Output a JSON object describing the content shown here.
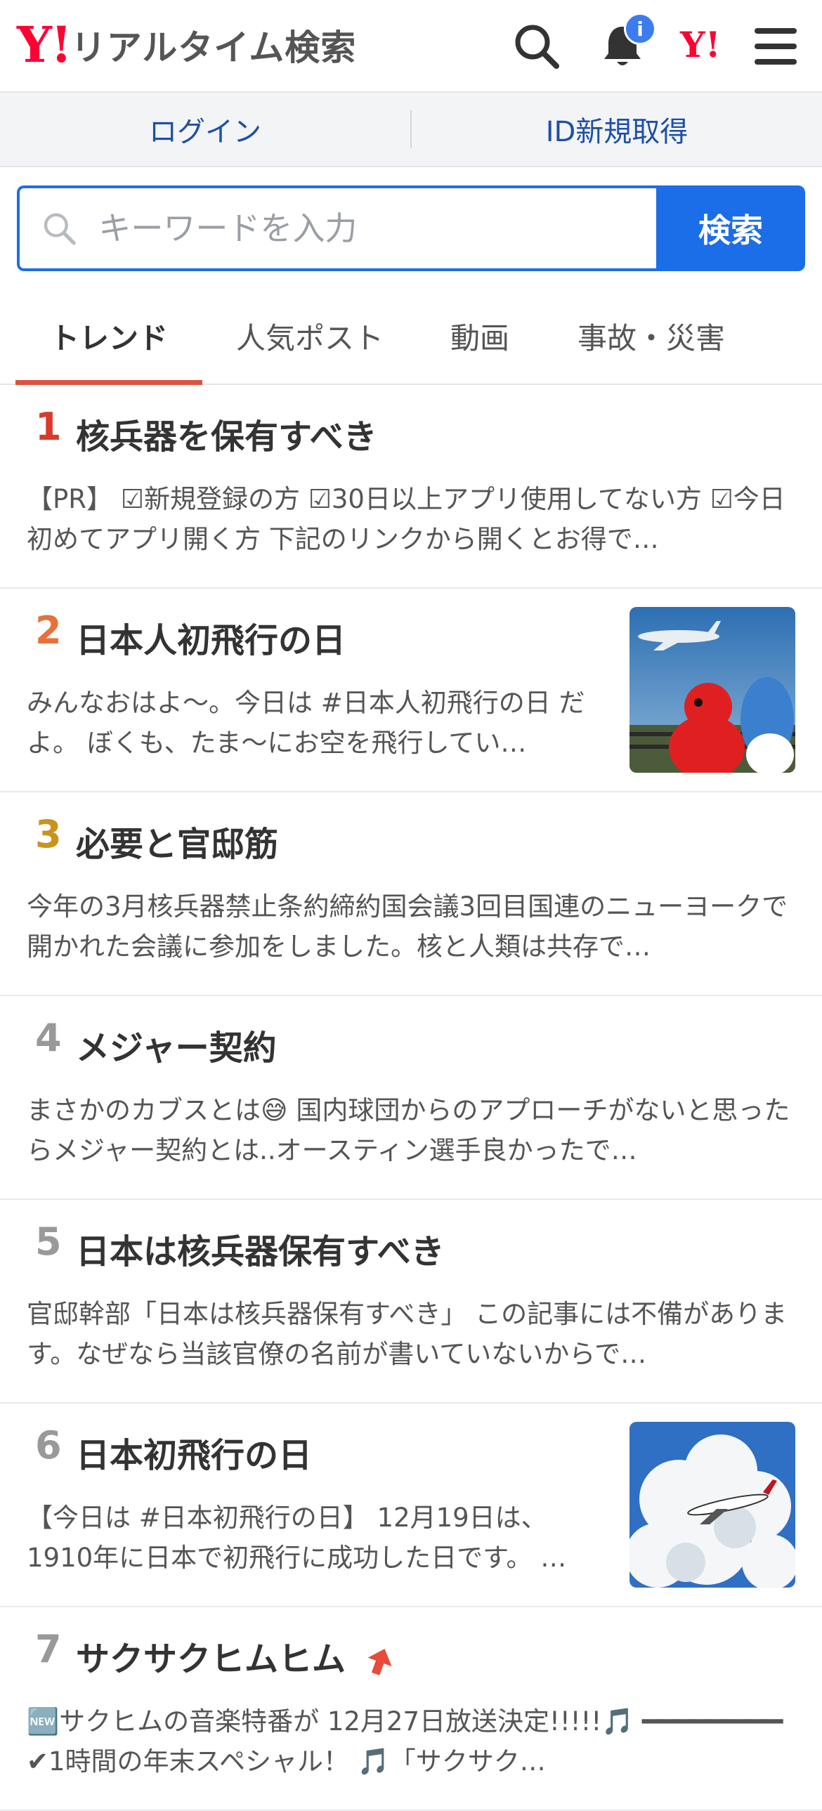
{
  "header": {
    "logo_mark": "Y!",
    "logo_text": "リアルタイム検索",
    "notification_badge": "i",
    "yahoo_mark": "Y!"
  },
  "loginbar": {
    "login": "ログイン",
    "signup": "ID新規取得"
  },
  "search": {
    "placeholder": "キーワードを入力",
    "button": "検索"
  },
  "tabs": [
    {
      "label": "トレンド",
      "active": true
    },
    {
      "label": "人気ポスト",
      "active": false
    },
    {
      "label": "動画",
      "active": false
    },
    {
      "label": "事故・災害",
      "active": false
    }
  ],
  "colors": {
    "accent_blue": "#1c6ee8",
    "tab_underline": "#e0513e",
    "rank1": "#d93a2b",
    "rank2": "#e8703a",
    "rank3": "#c9941c",
    "rank_other": "#999999"
  },
  "trends": [
    {
      "rank": "1",
      "title": "核兵器を保有すべき",
      "text": "【PR】 ☑新規登録の方 ☑30日以上アプリ使用してない方 ☑今日初めてアプリ開く方 下記のリンクから開くとお得で…",
      "image": null
    },
    {
      "rank": "2",
      "title": "日本人初飛行の日",
      "text": "みんなおはよ〜。今日は #日本人初飛行の日 だよ。 ぼくも、たま〜にお空を飛行してい…",
      "image": "airplane-with-mascot"
    },
    {
      "rank": "3",
      "title": "必要と官邸筋",
      "text": "今年の3月核兵器禁止条約締約国会議3回目国連のニューヨークで開かれた会議に参加をしました。核と人類は共存で…",
      "image": null
    },
    {
      "rank": "4",
      "title": "メジャー契約",
      "text": "まさかのカブスとは😅 国内球団からのアプローチがないと思ったらメジャー契約とは..オースティン選手良かったで…",
      "image": null
    },
    {
      "rank": "5",
      "title": "日本は核兵器保有すべき",
      "text": "官邸幹部「日本は核兵器保有すべき」 この記事には不備があります。なぜなら当該官僚の名前が書いていないからで…",
      "image": null
    },
    {
      "rank": "6",
      "title": "日本初飛行の日",
      "text": "【今日は #日本初飛行の日】 12月19日は、1910年に日本で初飛行に成功した日です。 …",
      "image": "jet-in-clouds"
    },
    {
      "rank": "7",
      "title": "サクサクヒムヒム",
      "text": "🆕サクヒムの音楽特番が 12月27日放送決定!!!!!🎵 ━━━━━━━━━ ✔1時間の年末スペシャル！ 🎵「サクサク…",
      "image": null,
      "rising": true
    }
  ]
}
